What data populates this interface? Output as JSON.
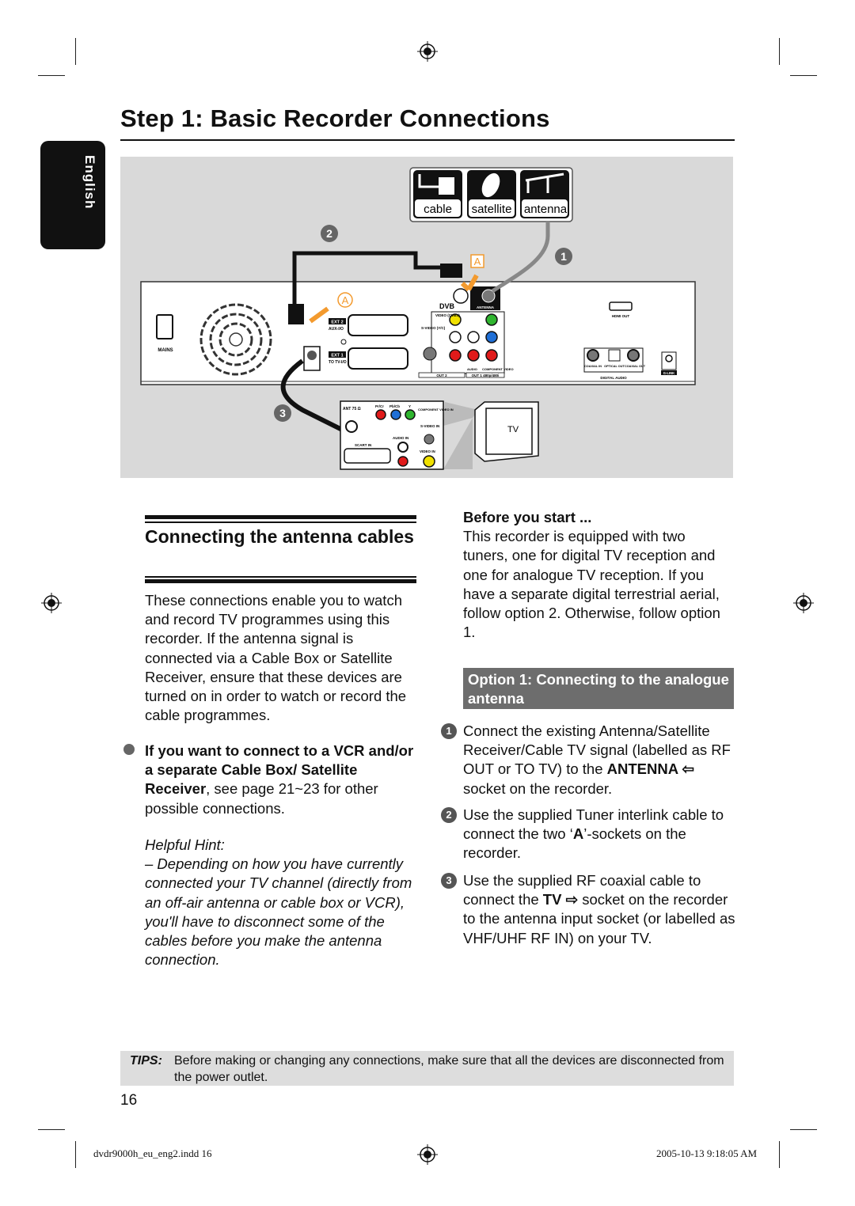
{
  "page": {
    "title": "Step 1: Basic Recorder Connections",
    "language_tab": "English",
    "page_number": "16"
  },
  "diagram": {
    "source_labels": [
      "cable",
      "satellite",
      "antenna"
    ],
    "callout_a": "A",
    "numbers": [
      "1",
      "2",
      "3"
    ],
    "recorder_labels": {
      "mains": "MAINS",
      "ext2": "EXT 2",
      "ext2_sub": "AUX-I/O",
      "ext1": "EXT 1",
      "ext1_sub": "TO TV-I/O",
      "dvb": "DVB",
      "antenna": "ANTENNA",
      "video": "VIDEO (CVBS)",
      "svideo": "S-VIDEO (Y/C)",
      "audio": "AUDIO",
      "component": "COMPONENT VIDEO",
      "out2": "OUT 2",
      "out1": "OUT 1  480p/480i",
      "hdmi": "HDMI OUT",
      "coaxial_in": "COAXIAL IN",
      "optical_out": "OPTICAL OUT",
      "coaxial_out": "COAXIAL OUT",
      "digital_audio": "DIGITAL  AUDIO",
      "glink": "G-LINK"
    },
    "tv_labels": {
      "ant": "ANT 75 Ω",
      "prcr": "Pr/Cr",
      "pbcb": "Pb/Cb",
      "y": "Y",
      "component_in": "COMPONENT VIDEO IN",
      "svideo_in": "S-VIDEO IN",
      "audio_in": "AUDIO IN",
      "scart_in": "SCART IN",
      "video_in": "VIDEO IN",
      "tv": "TV"
    },
    "colors": {
      "background": "#d9d9d9",
      "accent_orange": "#f39a2e",
      "yellow": "#f0e000",
      "green": "#2fb52f",
      "blue": "#1f6fd6",
      "red": "#e01a1a"
    }
  },
  "left": {
    "heading": "Connecting the antenna cables",
    "intro": "These connections enable you to watch and record TV programmes using this recorder. If the antenna signal is connected via a Cable Box or Satellite Receiver, ensure that these devices are turned on in order to watch or record the cable programmes.",
    "bullet_bold1": "If you want to connect to a VCR and/or a separate Cable Box/ Satellite Receiver",
    "bullet_rest": ", see page 21~23 for other possible connections.",
    "hint_title": "Helpful Hint:",
    "hint_text": "– Depending on how you have currently connected your TV channel (directly from an off-air antenna or cable box or VCR), you'll have to disconnect some of the cables before you make the antenna connection."
  },
  "right": {
    "before_title": "Before you start ...",
    "before_text": "This recorder is equipped with two tuners, one for digital TV reception and one for analogue TV reception.  If you have a separate digital terrestrial aerial, follow option 2.  Otherwise, follow option 1.",
    "option_title": "Option 1: Connecting to the analogue antenna",
    "steps": [
      {
        "num": "1",
        "a": "Connect the existing Antenna/Satellite Receiver/Cable TV signal (labelled as RF OUT or TO TV) to the ",
        "b": "ANTENNA ⇦",
        "c": " socket on the recorder."
      },
      {
        "num": "2",
        "a": "Use the supplied Tuner interlink cable to connect the two ‘",
        "b": "A",
        "c": "’-sockets on the recorder."
      },
      {
        "num": "3",
        "a": "Use the supplied RF coaxial cable to connect the ",
        "b": "TV ⇨",
        "c": " socket on the recorder to the antenna input socket (or labelled as VHF/UHF RF IN) on your TV."
      }
    ]
  },
  "tips": {
    "label": "TIPS:",
    "text": "Before making or changing any connections, make sure that all the devices are disconnected from the power outlet."
  },
  "footer": {
    "file": "dvdr9000h_eu_eng2.indd   16",
    "timestamp": "2005-10-13   9:18:05 AM"
  }
}
